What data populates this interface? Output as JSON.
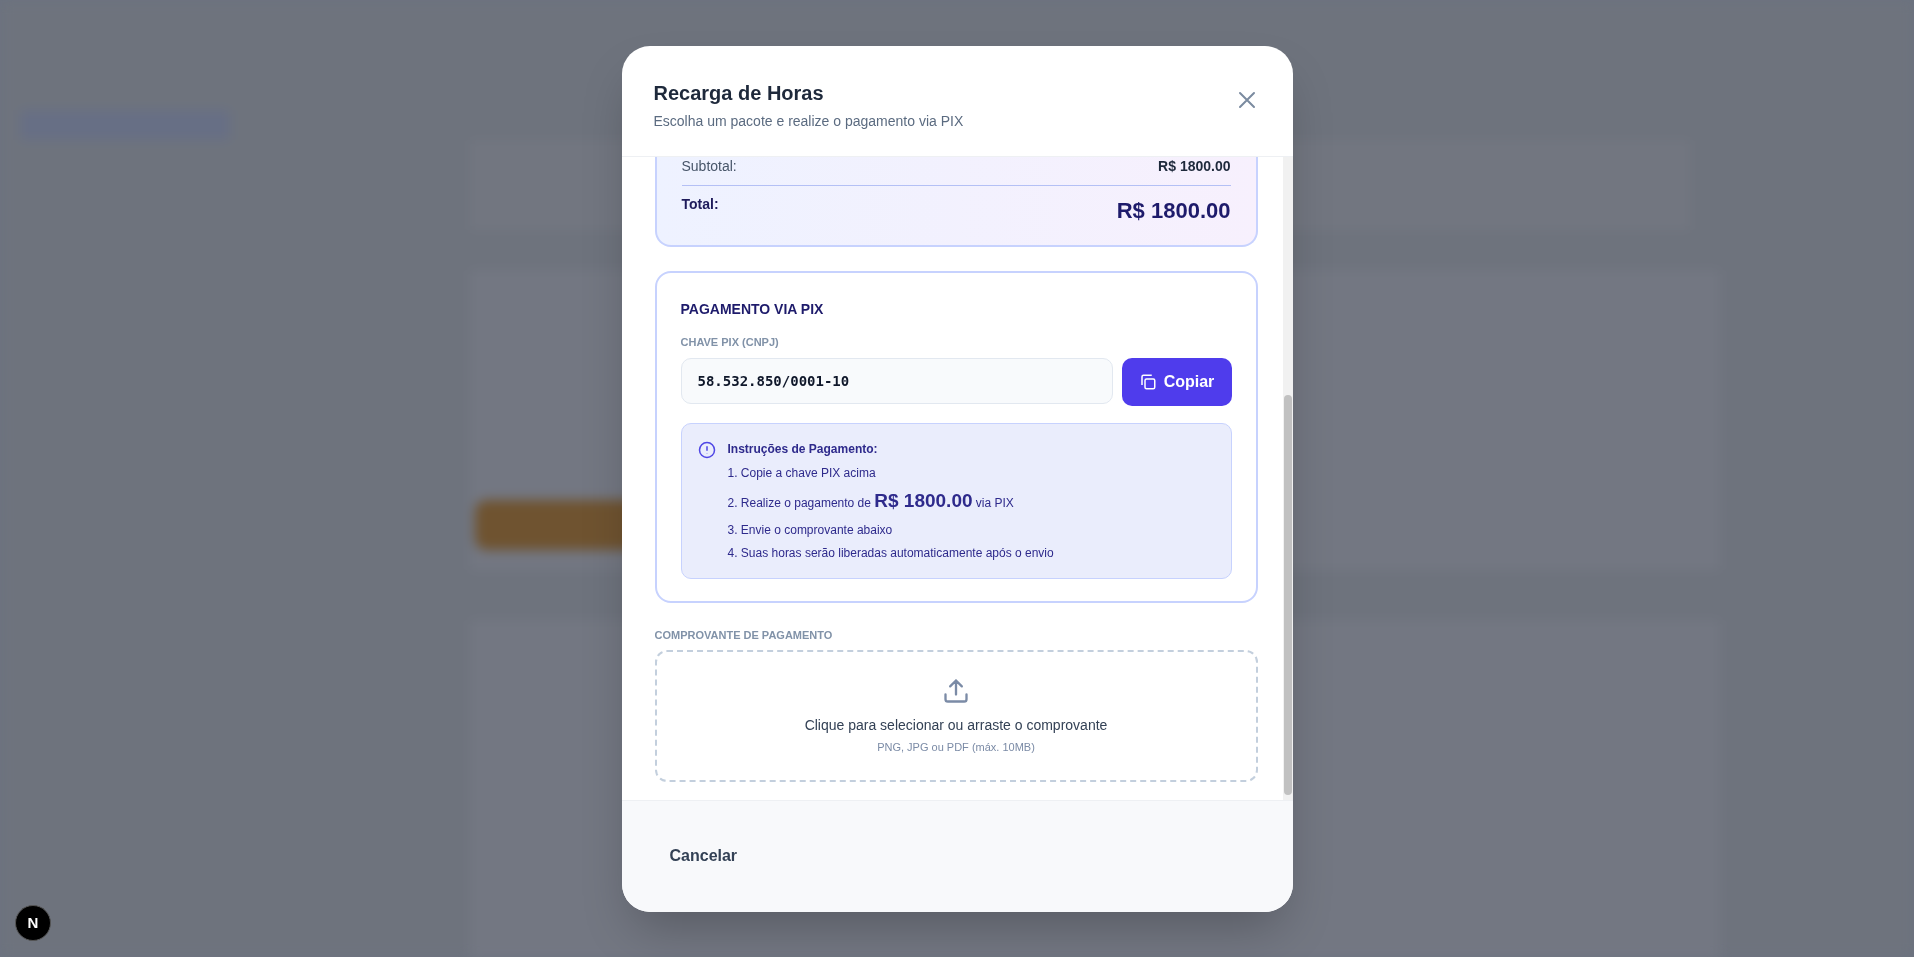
{
  "dialog": {
    "title": "Recarga de Horas",
    "subtitle": "Escolha um pacote e realize o pagamento via PIX"
  },
  "summary": {
    "subtotal_label": "Subtotal:",
    "subtotal_value": "R$ 1800.00",
    "total_label": "Total:",
    "total_value": "R$ 1800.00"
  },
  "pix": {
    "title": "PAGAMENTO VIA PIX",
    "key_label": "CHAVE PIX (CNPJ)",
    "key_value": "58.532.850/0001-10",
    "copy_button": "Copiar",
    "instructions_title": "Instruções de Pagamento:",
    "instructions": [
      "1. Copie a chave PIX acima",
      "2. Realize o pagamento de **R$ 1800.00** via PIX",
      "3. Envie o comprovante abaixo",
      "4. Suas horas serão liberadas automaticamente após o envio"
    ]
  },
  "upload": {
    "label": "COMPROVANTE DE PAGAMENTO",
    "prompt": "Clique para selecionar ou arraste o comprovante",
    "hint": "PNG, JPG ou PDF (máx. 10MB)"
  },
  "footer": {
    "cancel_button": "Cancelar"
  },
  "dev_badge": "N"
}
